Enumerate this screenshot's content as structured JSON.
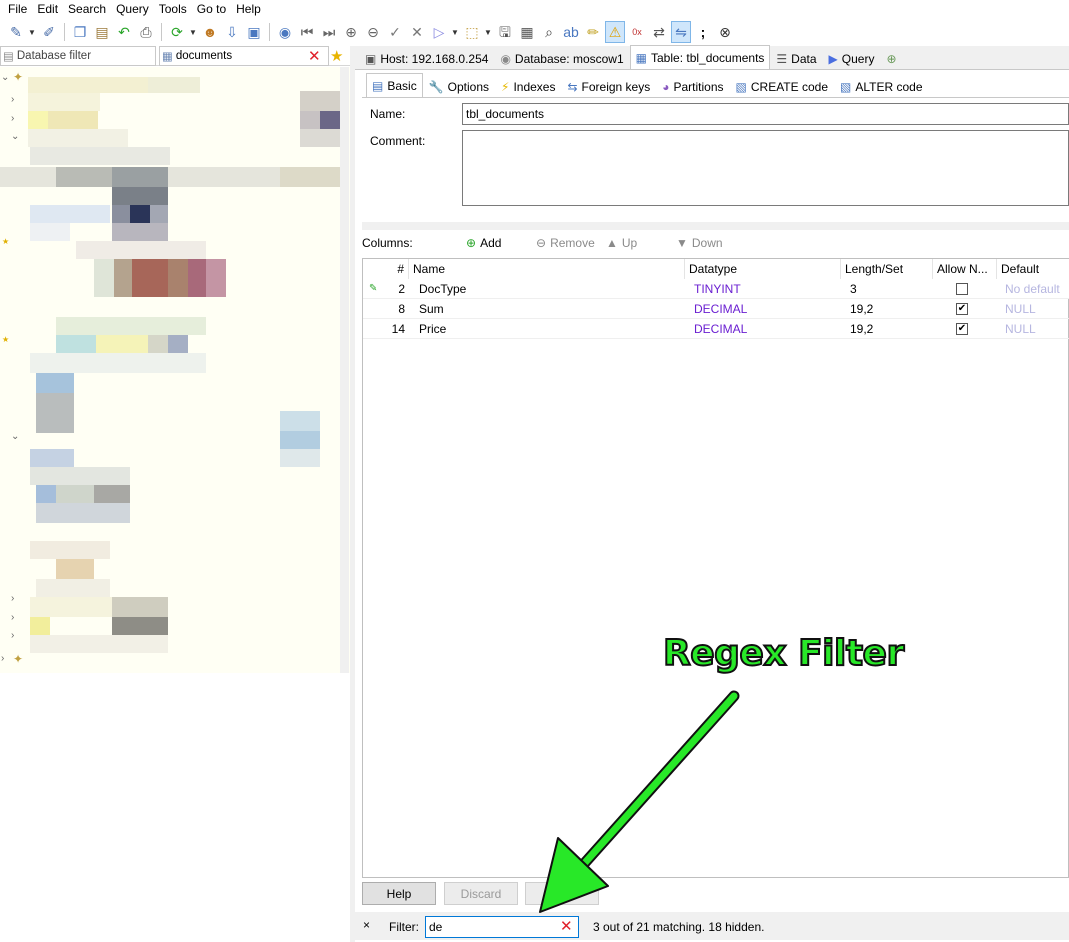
{
  "menu": [
    "File",
    "Edit",
    "Search",
    "Query",
    "Tools",
    "Go to",
    "Help"
  ],
  "left": {
    "db_filter_placeholder": "Database filter",
    "table_filter_value": "documents"
  },
  "tabs": {
    "host": "Host: 192.168.0.254",
    "database": "Database: moscow1",
    "table": "Table: tbl_documents",
    "data": "Data",
    "query": "Query"
  },
  "inner_tabs": [
    "Basic",
    "Options",
    "Indexes",
    "Foreign keys",
    "Partitions",
    "CREATE code",
    "ALTER code"
  ],
  "form": {
    "name_label": "Name:",
    "name_value": "tbl_documents",
    "comment_label": "Comment:"
  },
  "columns_bar": {
    "label": "Columns:",
    "add": "Add",
    "remove": "Remove",
    "up": "Up",
    "down": "Down"
  },
  "grid": {
    "headers": [
      "#",
      "Name",
      "Datatype",
      "Length/Set",
      "Allow N...",
      "Default"
    ],
    "rows": [
      {
        "num": "2",
        "name": "DocType",
        "datatype": "TINYINT",
        "length": "3",
        "allow_null": false,
        "default": "No default"
      },
      {
        "num": "8",
        "name": "Sum",
        "datatype": "DECIMAL",
        "length": "19,2",
        "allow_null": true,
        "default": "NULL"
      },
      {
        "num": "14",
        "name": "Price",
        "datatype": "DECIMAL",
        "length": "19,2",
        "allow_null": true,
        "default": "NULL"
      }
    ]
  },
  "buttons": {
    "help": "Help",
    "discard": "Discard",
    "save": ""
  },
  "filter": {
    "label": "Filter:",
    "value": "de",
    "status": "3 out of 21 matching. 18 hidden."
  },
  "annotation": "Regex Filter",
  "colors": {
    "accent": "#0078d7",
    "annotation": "#28e828",
    "datatype": "#6a1fd1",
    "clear_x": "#e0202a"
  }
}
